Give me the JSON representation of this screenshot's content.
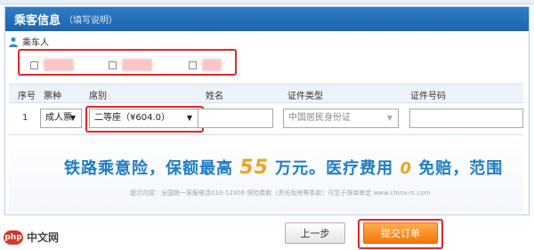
{
  "panel": {
    "title": "乘客信息",
    "help": "（填写说明）"
  },
  "passengers": {
    "label": "乘车人",
    "items": [
      {
        "name": ""
      },
      {
        "name": ""
      },
      {
        "name": ""
      }
    ]
  },
  "table": {
    "headers": [
      "序号",
      "票种",
      "席别",
      "姓名",
      "证件类型",
      "证件号码"
    ],
    "row": {
      "index": "1",
      "ticket_type": "成人票",
      "seat": "二等座（¥604.0）",
      "name": "",
      "id_type": "中国居民身份证",
      "id_number": ""
    }
  },
  "insurance": {
    "part1": "铁路乘意险，保额最高 ",
    "amount": "55",
    "part2": " 万元。医疗费用 ",
    "zero": "0",
    "part3": " 免赔，范围",
    "note": "提示内容：全国统一客服电话010-12306  保险费款（责任免除等条款）可至于保单审定  www.china-rc.com"
  },
  "buttons": {
    "prev": "上一步",
    "submit": "提交订单"
  },
  "watermark": {
    "logo": "php",
    "text": "中文网"
  }
}
